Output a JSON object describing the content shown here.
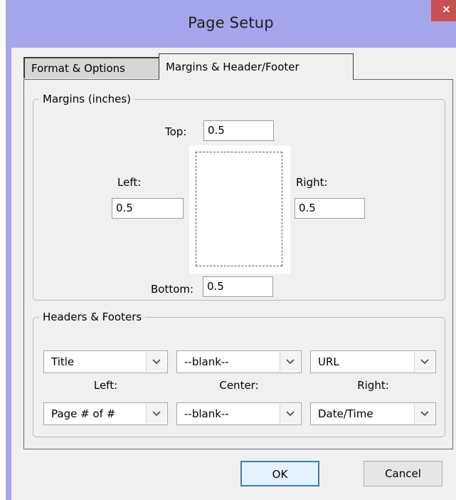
{
  "window": {
    "title": "Page Setup",
    "close_glyph": "×"
  },
  "tabs": [
    {
      "label": "Format & Options",
      "selected": false
    },
    {
      "label": "Margins & Header/Footer",
      "selected": true
    }
  ],
  "margins": {
    "group_label": "Margins (inches)",
    "top_label": "Top:",
    "top_value": "0.5",
    "left_label": "Left:",
    "left_value": "0.5",
    "right_label": "Right:",
    "right_value": "0.5",
    "bottom_label": "Bottom:",
    "bottom_value": "0.5"
  },
  "headers_footers": {
    "group_label": "Headers & Footers",
    "header_left": "Title",
    "header_center": "--blank--",
    "header_right": "URL",
    "left_label": "Left:",
    "center_label": "Center:",
    "right_label": "Right:",
    "footer_left": "Page # of #",
    "footer_center": "--blank--",
    "footer_right": "Date/Time"
  },
  "buttons": {
    "ok": "OK",
    "cancel": "Cancel"
  },
  "colors": {
    "title_bar": "#a4a6ec",
    "close_button": "#c75050",
    "dialog_bg": "#f0f0f0",
    "ok_border": "#3c7fb1"
  }
}
